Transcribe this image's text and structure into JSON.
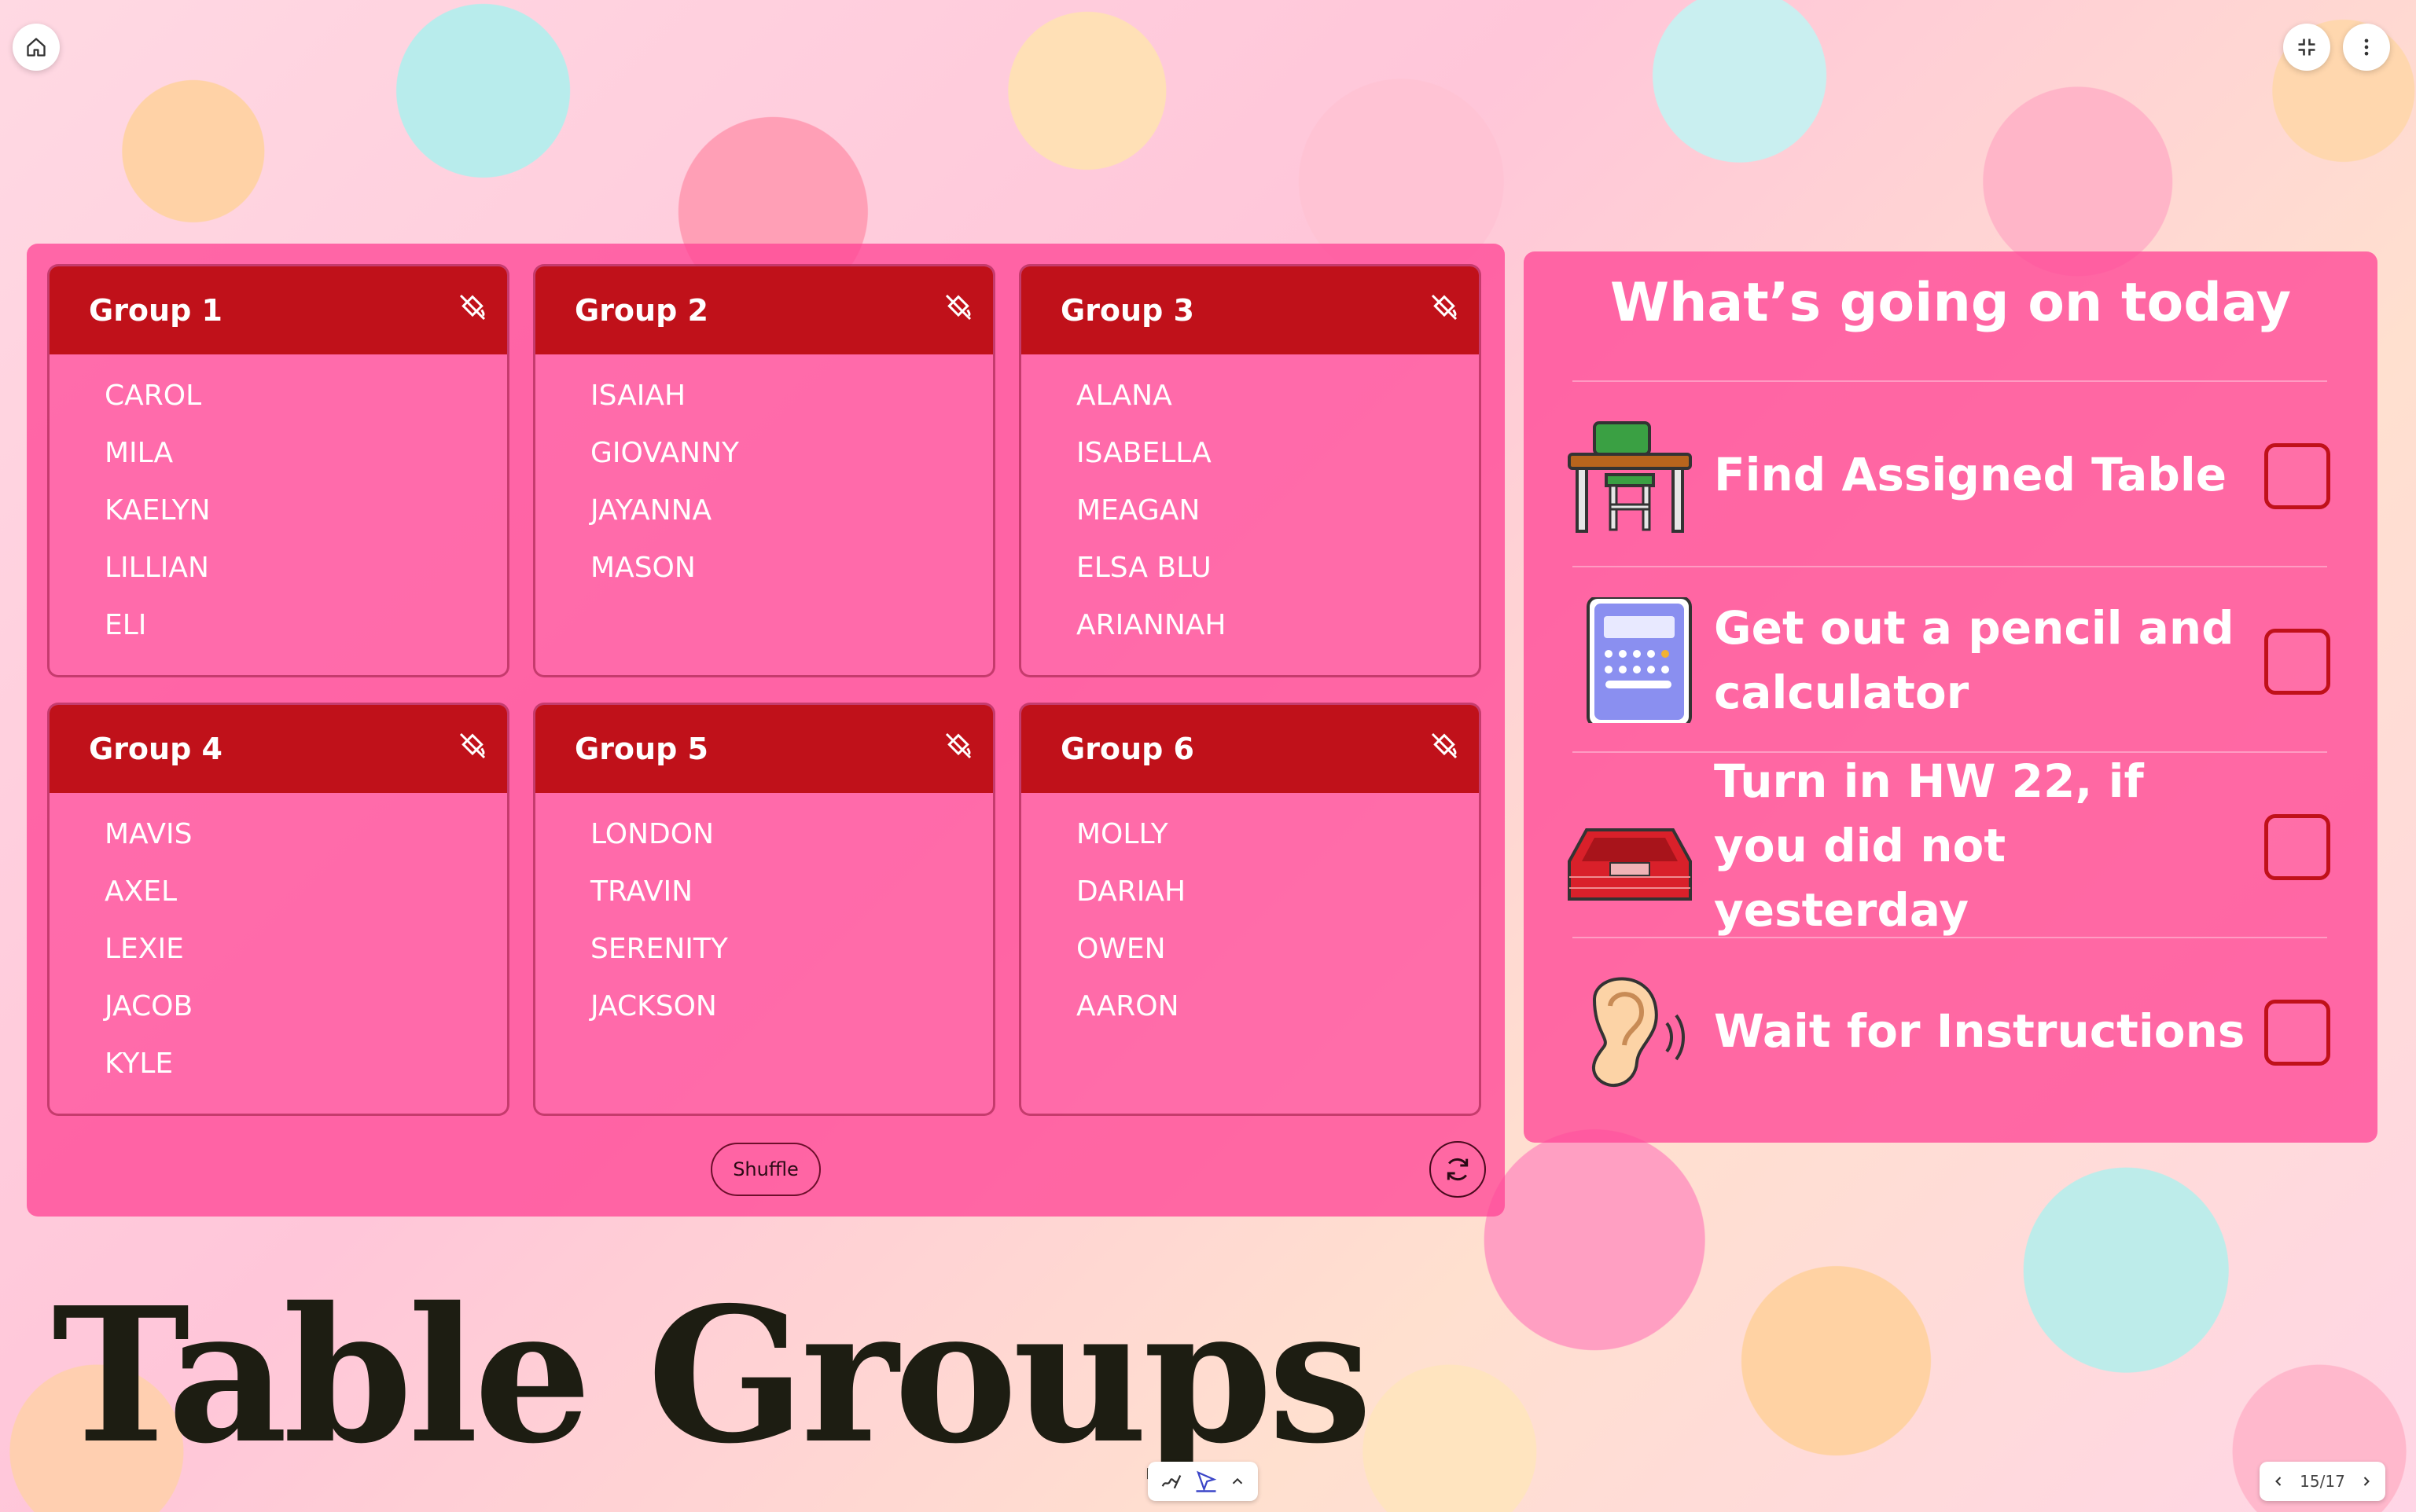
{
  "toolbar": {
    "home_icon": "home-icon",
    "collapse_icon": "collapse-icon",
    "more_icon": "more-vertical-icon"
  },
  "groups": [
    {
      "title": "Group 1",
      "members": [
        "CAROL",
        "MILA",
        "KAELYN",
        "LILLIAN",
        "ELI"
      ]
    },
    {
      "title": "Group 2",
      "members": [
        "ISAIAH",
        "GIOVANNY",
        "JAYANNA",
        "MASON"
      ]
    },
    {
      "title": "Group 3",
      "members": [
        "ALANA",
        "ISABELLA",
        "MEAGAN",
        "ELSA BLU",
        "ARIANNAH"
      ]
    },
    {
      "title": "Group 4",
      "members": [
        "MAVIS",
        "AXEL",
        "LEXIE",
        "JACOB",
        "KYLE"
      ]
    },
    {
      "title": "Group 5",
      "members": [
        "LONDON",
        "TRAVIN",
        "SERENITY",
        "JACKSON"
      ]
    },
    {
      "title": "Group 6",
      "members": [
        "MOLLY",
        "DARIAH",
        "OWEN",
        "AARON"
      ]
    }
  ],
  "shuffle_label": "Shuffle",
  "agenda": {
    "title": "What’s going on today",
    "items": [
      {
        "text": "Find Assigned Table",
        "icon": "desk-icon",
        "checked": false
      },
      {
        "text": "Get out a pencil and calculator",
        "icon": "calculator-icon",
        "checked": false
      },
      {
        "text": "Turn in HW 22, if you did not yesterday",
        "icon": "inbox-tray-icon",
        "checked": false
      },
      {
        "text": "Wait for Instructions",
        "icon": "ear-icon",
        "checked": false
      }
    ]
  },
  "slide_title": "Table Groups",
  "pager": {
    "label": "15/17"
  },
  "colors": {
    "panel": "#ff4696",
    "group_header": "#c0111a",
    "checkbox": "#c0111a"
  }
}
